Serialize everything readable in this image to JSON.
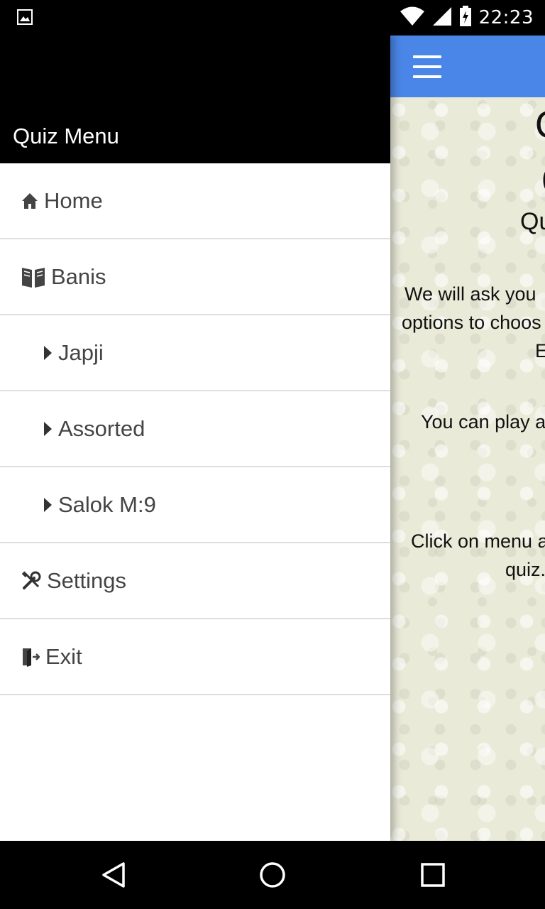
{
  "status_bar": {
    "time": "22:23",
    "icons": [
      "image-icon",
      "wifi-icon",
      "signal-icon",
      "battery-charging-icon"
    ]
  },
  "app": {
    "menu_icon": "hamburger-icon",
    "content_fragments": [
      {
        "key": "l1",
        "text": "Q"
      },
      {
        "key": "l2",
        "text": "("
      },
      {
        "key": "l3",
        "text": "Qu"
      },
      {
        "key": "l4",
        "text": "We will ask you"
      },
      {
        "key": "l5",
        "text": "options to choos"
      },
      {
        "key": "l6",
        "text": "E"
      },
      {
        "key": "l7",
        "text": "You can play a"
      },
      {
        "key": "l8",
        "text": "Click on menu a"
      },
      {
        "key": "l9",
        "text": "quiz."
      }
    ]
  },
  "drawer": {
    "title": "Quiz Menu",
    "items": [
      {
        "label": "Home",
        "icon": "home-icon",
        "level": 0
      },
      {
        "label": "Banis",
        "icon": "book-icon",
        "level": 0
      },
      {
        "label": "Japji",
        "icon": "caret-right-icon",
        "level": 1
      },
      {
        "label": "Assorted",
        "icon": "caret-right-icon",
        "level": 1
      },
      {
        "label": "Salok M:9",
        "icon": "caret-right-icon",
        "level": 1
      },
      {
        "label": "Settings",
        "icon": "tools-icon",
        "level": 0
      },
      {
        "label": "Exit",
        "icon": "exit-icon",
        "level": 0
      }
    ]
  },
  "nav_bar": {
    "buttons": [
      "back-icon",
      "home-circle-icon",
      "recents-icon"
    ]
  }
}
